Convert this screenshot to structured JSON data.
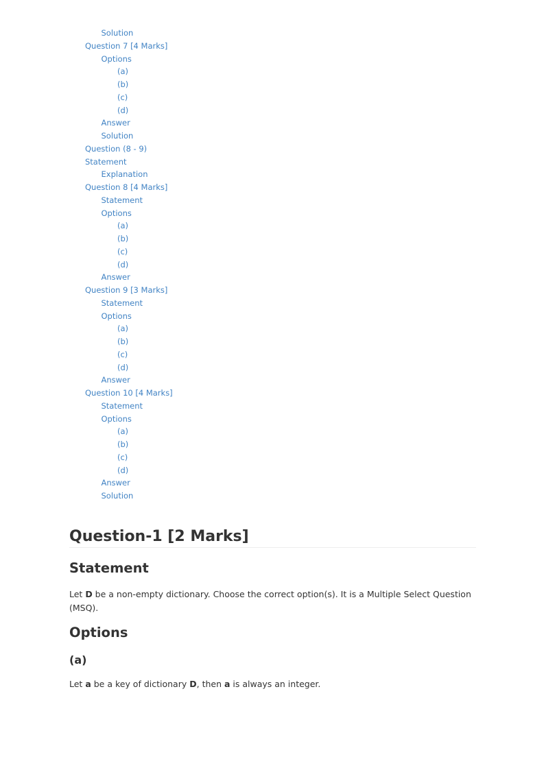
{
  "toc": [
    {
      "label": "Solution",
      "level": 2
    },
    {
      "label": "Question 7 [4 Marks]",
      "level": 1
    },
    {
      "label": "Options",
      "level": 2
    },
    {
      "label": "(a)",
      "level": 3
    },
    {
      "label": "(b)",
      "level": 3
    },
    {
      "label": "(c)",
      "level": 3
    },
    {
      "label": "(d)",
      "level": 3
    },
    {
      "label": "Answer",
      "level": 2
    },
    {
      "label": "Solution",
      "level": 2
    },
    {
      "label": "Question (8 - 9)",
      "level": 1
    },
    {
      "label": "Statement",
      "level": 1
    },
    {
      "label": "Explanation",
      "level": 2
    },
    {
      "label": "Question 8 [4 Marks]",
      "level": 1
    },
    {
      "label": "Statement",
      "level": 2
    },
    {
      "label": "Options",
      "level": 2
    },
    {
      "label": "(a)",
      "level": 3
    },
    {
      "label": "(b)",
      "level": 3
    },
    {
      "label": "(c)",
      "level": 3
    },
    {
      "label": "(d)",
      "level": 3
    },
    {
      "label": "Answer",
      "level": 2
    },
    {
      "label": "Question 9 [3 Marks]",
      "level": 1
    },
    {
      "label": "Statement",
      "level": 2
    },
    {
      "label": "Options",
      "level": 2
    },
    {
      "label": "(a)",
      "level": 3
    },
    {
      "label": "(b)",
      "level": 3
    },
    {
      "label": "(c)",
      "level": 3
    },
    {
      "label": "(d)",
      "level": 3
    },
    {
      "label": "Answer",
      "level": 2
    },
    {
      "label": "Question 10 [4 Marks]",
      "level": 1
    },
    {
      "label": "Statement",
      "level": 2
    },
    {
      "label": "Options",
      "level": 2
    },
    {
      "label": "(a)",
      "level": 3
    },
    {
      "label": "(b)",
      "level": 3
    },
    {
      "label": "(c)",
      "level": 3
    },
    {
      "label": "(d)",
      "level": 3
    },
    {
      "label": "Answer",
      "level": 2
    },
    {
      "label": "Solution",
      "level": 2
    }
  ],
  "question": {
    "title": "Question-1 [2 Marks]",
    "statement_heading": "Statement",
    "statement": {
      "p1": "Let ",
      "b1": "D",
      "p2": " be a non-empty dictionary. Choose the correct option(s). It is a Multiple Select Question (MSQ)."
    },
    "options_heading": "Options",
    "option_a_label": "(a)",
    "option_a": {
      "p1": "Let ",
      "b1": "a",
      "p2": " be a key of dictionary ",
      "b2": "D",
      "p3": ", then ",
      "b3": "a",
      "p4": " is always an integer."
    }
  },
  "colors": {
    "link": "#4183c4",
    "text": "#333333",
    "rule": "#eeeeee"
  }
}
